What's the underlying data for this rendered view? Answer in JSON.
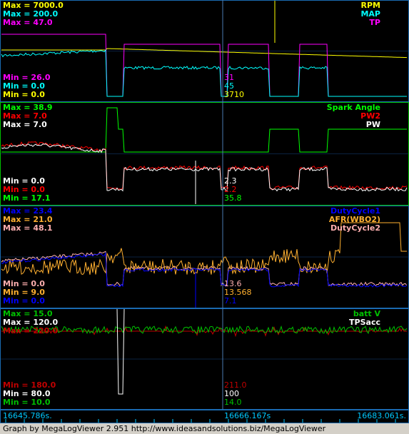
{
  "panels": [
    {
      "max": [
        {
          "text": "Max = 7000.0",
          "color": "#ffff00"
        },
        {
          "text": "Max = 200.0",
          "color": "#00ffff"
        },
        {
          "text": "Max = 47.0",
          "color": "#ff00ff"
        }
      ],
      "min": [
        {
          "text": "Min = 26.0",
          "color": "#ff00ff"
        },
        {
          "text": "Min = 0.0",
          "color": "#00ffff"
        },
        {
          "text": "Min = 0.0",
          "color": "#ffff00"
        }
      ],
      "cursor_values": [
        {
          "text": "31",
          "color": "#ff00ff"
        },
        {
          "text": "45",
          "color": "#00ffff"
        },
        {
          "text": "3710",
          "color": "#ffff00"
        }
      ],
      "legend": [
        {
          "text": "RPM",
          "color": "#ffff00"
        },
        {
          "text": "MAP",
          "color": "#00ffff"
        },
        {
          "text": "TP",
          "color": "#ff00ff"
        }
      ]
    },
    {
      "max": [
        {
          "text": "Max = 38.9",
          "color": "#00ff00"
        },
        {
          "text": "Max = 7.0",
          "color": "#ff0000"
        },
        {
          "text": "Max = 7.0",
          "color": "#ffffff"
        }
      ],
      "min": [
        {
          "text": "Min = 0.0",
          "color": "#ffffff"
        },
        {
          "text": "Min = 0.0",
          "color": "#ff0000"
        },
        {
          "text": "Min = 17.1",
          "color": "#00ff00"
        }
      ],
      "cursor_values": [
        {
          "text": "2.3",
          "color": "#ffffff"
        },
        {
          "text": "2.2",
          "color": "#ff0000"
        },
        {
          "text": "35.8",
          "color": "#00ff00"
        }
      ],
      "legend": [
        {
          "text": "Spark Angle",
          "color": "#00ff00"
        },
        {
          "text": "PW2",
          "color": "#ff0000"
        },
        {
          "text": "PW",
          "color": "#ffffff"
        }
      ]
    },
    {
      "max": [
        {
          "text": "Max = 23.4",
          "color": "#0000ff"
        },
        {
          "text": "Max = 21.0",
          "color": "#ffb030"
        },
        {
          "text": "Max = 48.1",
          "color": "#ffb0b0"
        }
      ],
      "min": [
        {
          "text": "Min = 0.0",
          "color": "#ffb0b0"
        },
        {
          "text": "Min = 9.0",
          "color": "#ffb030"
        },
        {
          "text": "Min = 0.0",
          "color": "#0000ff"
        }
      ],
      "cursor_values": [
        {
          "text": "13.6",
          "color": "#ffb0b0"
        },
        {
          "text": "13.568",
          "color": "#ffb030"
        },
        {
          "text": "7.1",
          "color": "#0000ff"
        }
      ],
      "legend": [
        {
          "text": "DutyCycle1",
          "color": "#0000ff"
        },
        {
          "text": "AFR(WBO2)",
          "color": "#ffb030"
        },
        {
          "text": "DutyCycle2",
          "color": "#ffb0b0"
        }
      ]
    },
    {
      "max": [
        {
          "text": "Max = 15.0",
          "color": "#00c000"
        },
        {
          "text": "Max = 120.0",
          "color": "#ffffff"
        },
        {
          "text": "Max = 220.0",
          "color": "#c00000"
        }
      ],
      "min": [
        {
          "text": "Min = 180.0",
          "color": "#c00000"
        },
        {
          "text": "Min = 80.0",
          "color": "#ffffff"
        },
        {
          "text": "Min = 10.0",
          "color": "#00c000"
        }
      ],
      "cursor_values": [
        {
          "text": "211.0",
          "color": "#c00000"
        },
        {
          "text": "100",
          "color": "#ffffff"
        },
        {
          "text": "14.0",
          "color": "#00c000"
        }
      ],
      "legend": [
        {
          "text": "batt V",
          "color": "#00c000"
        },
        {
          "text": "TPSacc",
          "color": "#ffffff"
        },
        {
          "text": "",
          "color": "#c00000"
        }
      ]
    }
  ],
  "time_axis": {
    "start": "16645.786s.",
    "cursor": "16666.167s",
    "end": "16683.061s."
  },
  "footer_text": "Graph by MegaLogViewer 2.951 http://www.ideasandsolutions.biz/MegaLogViewer",
  "colors": {
    "background": "#000000",
    "grid": "#3a6aa0",
    "cursor": "#4a7ab0",
    "panel_border": "#00a0ff"
  }
}
